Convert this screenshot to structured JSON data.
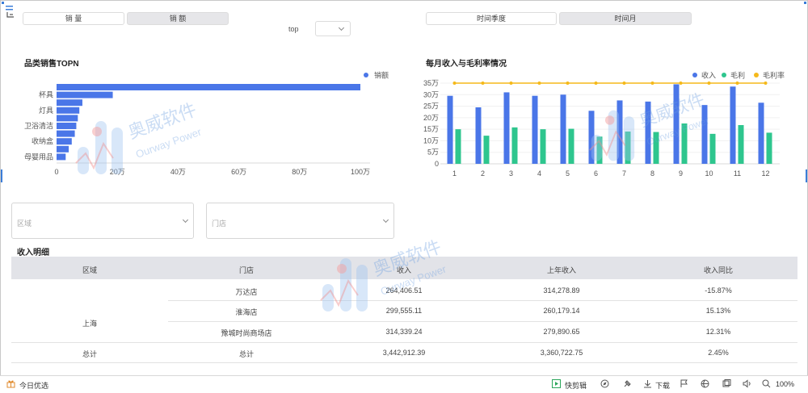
{
  "toggles": {
    "metric": [
      "销 量",
      "销 额"
    ],
    "metric_active": 1,
    "top_label": "top",
    "top_value": "",
    "time": [
      "时间季度",
      "时间月"
    ],
    "time_active": 1
  },
  "watermark": {
    "text_cn": "奥威软件",
    "text_en": "Ourway Power"
  },
  "left_chart": {
    "title": "品类销售TOPN",
    "chart_data": {
      "type": "bar",
      "orientation": "horizontal",
      "legend": [
        "销额"
      ],
      "legend_position": "top-right",
      "color": "#4a76e8",
      "category_labels": [
        "杯具",
        "灯具",
        "卫浴清洁",
        "收纳盒",
        "母婴用品"
      ],
      "values_wan": [
        100,
        18.5,
        8.5,
        7.5,
        7,
        6.5,
        6,
        5,
        4,
        3
      ],
      "x_ticks": [
        "0",
        "20万",
        "40万",
        "60万",
        "80万",
        "100万"
      ],
      "xlim": [
        0,
        100
      ]
    }
  },
  "right_chart": {
    "title": "每月收入与毛利率情况",
    "chart_data": {
      "type": "bar+line",
      "categories": [
        "1",
        "2",
        "3",
        "4",
        "5",
        "6",
        "7",
        "8",
        "9",
        "10",
        "11",
        "12"
      ],
      "series": [
        {
          "name": "收入",
          "type": "bar",
          "color": "#4a76e8",
          "values_wan": [
            29.5,
            24.5,
            31,
            29.5,
            30,
            23,
            27.5,
            27,
            34.5,
            25.5,
            33.5,
            26.5
          ]
        },
        {
          "name": "毛利",
          "type": "bar",
          "color": "#2ec68e",
          "values_wan": [
            15,
            12.2,
            15.8,
            15,
            15.2,
            11.8,
            14,
            13.8,
            17.5,
            13,
            16.8,
            13.5
          ]
        },
        {
          "name": "毛利率",
          "type": "line",
          "color": "#f5b91a",
          "values_wan": [
            35,
            35,
            35,
            35,
            35,
            35,
            35,
            35,
            35,
            35,
            35,
            35
          ]
        }
      ],
      "y_ticks": [
        "0",
        "5万",
        "10万",
        "15万",
        "20万",
        "25万",
        "30万",
        "35万"
      ],
      "ylim": [
        0,
        35
      ],
      "legend_position": "top-right"
    }
  },
  "filters": {
    "region_placeholder": "区域",
    "store_placeholder": "门店"
  },
  "table": {
    "title": "收入明细",
    "headers": [
      "区域",
      "门店",
      "收入",
      "上年收入",
      "收入同比"
    ],
    "region": "上海",
    "rows": [
      {
        "store": "万达店",
        "revenue": "264,406.51",
        "last_year": "314,278.89",
        "yoy": "-15.87%"
      },
      {
        "store": "淮海店",
        "revenue": "299,555.11",
        "last_year": "260,179.14",
        "yoy": "15.13%"
      },
      {
        "store": "豫城时尚商场店",
        "revenue": "314,339.24",
        "last_year": "279,890.65",
        "yoy": "12.31%"
      }
    ],
    "total": {
      "region": "总计",
      "store": "总计",
      "revenue": "3,442,912.39",
      "last_year": "3,360,722.75",
      "yoy": "2.45%"
    }
  },
  "status_bar": {
    "left_label": "今日优选",
    "clip_label": "快剪辑",
    "download_label": "下载",
    "zoom": "100%"
  }
}
